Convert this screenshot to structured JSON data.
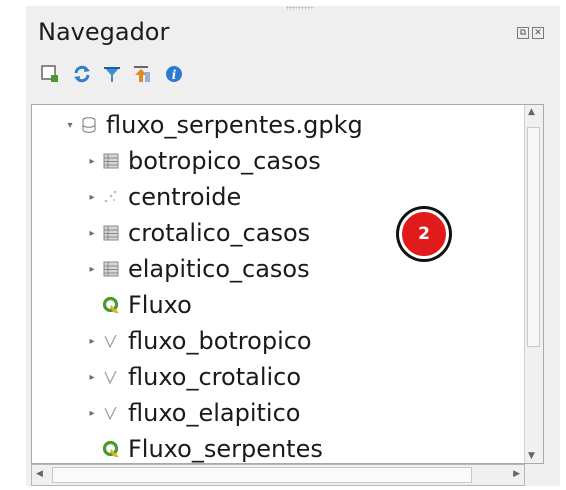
{
  "panel": {
    "title": "Navegador",
    "float_icon": "⧉",
    "close_icon": "✕"
  },
  "toolbar": {
    "buttons": [
      {
        "name": "add-selected-layers-icon"
      },
      {
        "name": "refresh-icon"
      },
      {
        "name": "filter-icon"
      },
      {
        "name": "collapse-all-icon"
      },
      {
        "name": "properties-info-icon"
      }
    ]
  },
  "tree": {
    "root": {
      "label": "fluxo_serpentes.gpkg",
      "icon": "database-icon",
      "expanded": true
    },
    "items": [
      {
        "label": "botropico_casos",
        "icon": "table-icon",
        "has_children": true
      },
      {
        "label": "centroide",
        "icon": "point-layer-icon",
        "has_children": true
      },
      {
        "label": "crotalico_casos",
        "icon": "table-icon",
        "has_children": true
      },
      {
        "label": "elapitico_casos",
        "icon": "table-icon",
        "has_children": true
      },
      {
        "label": "Fluxo",
        "icon": "qgis-project-icon",
        "has_children": false
      },
      {
        "label": "fluxo_botropico",
        "icon": "line-layer-icon",
        "has_children": true
      },
      {
        "label": "fluxo_crotalico",
        "icon": "line-layer-icon",
        "has_children": true
      },
      {
        "label": "fluxo_elapitico",
        "icon": "line-layer-icon",
        "has_children": true
      },
      {
        "label": "Fluxo_serpentes",
        "icon": "qgis-project-icon",
        "has_children": false
      }
    ]
  },
  "annotation": {
    "badge_number": "2",
    "color": "#e11b1b"
  },
  "colors": {
    "panel_bg": "#efefef",
    "tree_bg": "#ffffff",
    "qgis_green": "#4a9a2b"
  }
}
